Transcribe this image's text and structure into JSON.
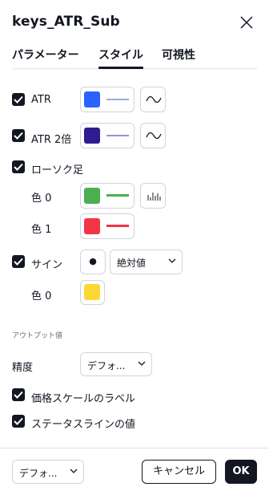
{
  "dialog": {
    "title": "keys_ATR_Sub",
    "tabs": [
      {
        "label": "パラメーター",
        "active": false
      },
      {
        "label": "スタイル",
        "active": true
      },
      {
        "label": "可視性",
        "active": false
      }
    ]
  },
  "style": {
    "rows": [
      {
        "label": "ATR",
        "checked": true,
        "color": "#2962ff",
        "line_color": "#9fa8da",
        "icon": "wave-icon"
      },
      {
        "label": "ATR 2倍",
        "checked": true,
        "color": "#311b92",
        "line_color": "#9b8fd6",
        "icon": "wave-icon"
      },
      {
        "label": "ローソク足",
        "checked": true
      },
      {
        "label": "色 0",
        "color": "#4caf50",
        "line_color": "#4caf50",
        "icon": "bars-icon"
      },
      {
        "label": "色 1",
        "color": "#f23645",
        "line_color": "#f23645"
      },
      {
        "label": "サイン",
        "checked": true,
        "shape": "●",
        "select_value": "絶対値"
      },
      {
        "label": "色 0",
        "color": "#fdd835"
      }
    ],
    "outputs_section": "アウトプット値",
    "precision_label": "精度",
    "precision_value": "デフォ...",
    "scale_label": "価格スケールのラベル",
    "scale_checked": true,
    "status_label": "ステータスラインの値",
    "status_checked": true
  },
  "footer": {
    "defaults_value": "デフォ...",
    "cancel_label": "キャンセル",
    "ok_label": "OK"
  }
}
